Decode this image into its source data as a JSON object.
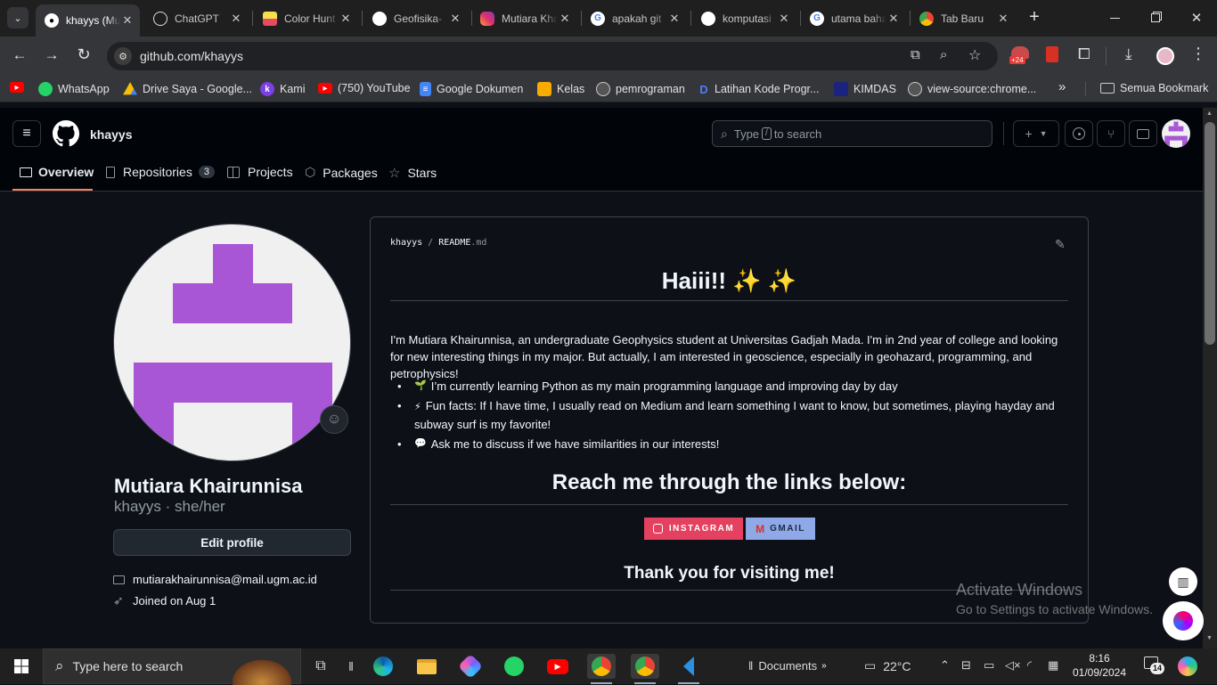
{
  "browser": {
    "tabs": [
      {
        "title": "khayys (Mutiara Khairunnisa)",
        "active": true,
        "icon": "github-icon"
      },
      {
        "title": "ChatGPT",
        "icon": "chatgpt-icon"
      },
      {
        "title": "Color Hunt",
        "icon": "colorhunt-icon"
      },
      {
        "title": "Geofisika-",
        "icon": "github-icon"
      },
      {
        "title": "Mutiara Khairunnisa",
        "icon": "instagram-icon"
      },
      {
        "title": "apakah git",
        "icon": "google-icon"
      },
      {
        "title": "komputasi",
        "icon": "github-icon"
      },
      {
        "title": "utama bahasa",
        "icon": "google-icon"
      },
      {
        "title": "Tab Baru",
        "icon": "chrome-icon"
      }
    ],
    "url": "github.com/khayys",
    "extension_badge": "+24",
    "bookmarks": [
      {
        "label": "",
        "icon": "youtube-icon"
      },
      {
        "label": "WhatsApp",
        "icon": "whatsapp-icon"
      },
      {
        "label": "Drive Saya - Google...",
        "icon": "drive-icon"
      },
      {
        "label": "Kami",
        "icon": "kami-icon"
      },
      {
        "label": "(750) YouTube",
        "icon": "youtube-icon"
      },
      {
        "label": "Google Dokumen",
        "icon": "docs-icon"
      },
      {
        "label": "Kelas",
        "icon": "classroom-icon"
      },
      {
        "label": "pemrograman",
        "icon": "globe-icon"
      },
      {
        "label": "Latihan Kode Progr...",
        "icon": "dicoding-icon"
      },
      {
        "label": "KIMDAS",
        "icon": "kimdas-icon"
      },
      {
        "label": "view-source:chrome...",
        "icon": "globe-icon"
      }
    ],
    "all_bookmarks": "Semua Bookmark"
  },
  "github": {
    "username": "khayys",
    "search_placeholder": "Type [/] to search",
    "search_pre": "Type",
    "search_key": "/",
    "search_post": "to search",
    "nav": [
      {
        "label": "Overview",
        "icon": "book-icon",
        "active": true
      },
      {
        "label": "Repositories",
        "icon": "repo-icon",
        "count": "3"
      },
      {
        "label": "Projects",
        "icon": "table-icon"
      },
      {
        "label": "Packages",
        "icon": "package-icon"
      },
      {
        "label": "Stars",
        "icon": "star-icon"
      }
    ]
  },
  "profile": {
    "name": "Mutiara Khairunnisa",
    "handle_line": "khayys · she/her",
    "edit_button": "Edit profile",
    "email": "mutiarakhairunnisa@mail.ugm.ac.id",
    "joined": "Joined on Aug 1",
    "avatar_color": "#a855d6"
  },
  "readme": {
    "path_user": "khayys",
    "path_sep": "/",
    "path_file": "README",
    "path_ext": ".md",
    "heading": "Haiii!! ✨ ✨",
    "intro": "I'm Mutiara Khairunnisa, an undergraduate Geophysics student at Universitas Gadjah Mada. I'm in 2nd year of college and looking for new interesting things in my major. But actually, I am interested in geoscience, especially in geohazard, programming, and petrophysics!",
    "bullets": [
      {
        "emoji": "🌱",
        "text": "I’m currently learning Python as my main programming language and improving day by day"
      },
      {
        "emoji": "⚡",
        "text": "Fun facts: If I have time, I usually read on Medium and learn something I want to know, but sometimes, playing hayday and subway surf is my favorite!"
      },
      {
        "emoji": "💬",
        "text": "Ask me to discuss if we have similarities in our interests!"
      }
    ],
    "reach_heading": "Reach me through the links below:",
    "badges": [
      {
        "label": "INSTAGRAM",
        "color": "#e4405f"
      },
      {
        "label": "GMAIL",
        "color": "#8ea8e8"
      }
    ],
    "thanks": "Thank you for visiting me!"
  },
  "watermark": {
    "line1": "Activate Windows",
    "line2": "Go to Settings to activate Windows."
  },
  "taskbar": {
    "search_placeholder": "Type here to search",
    "documents": "Documents",
    "temperature": "22°C",
    "time": "8:16",
    "date": "01/09/2024",
    "notification_count": "14"
  }
}
